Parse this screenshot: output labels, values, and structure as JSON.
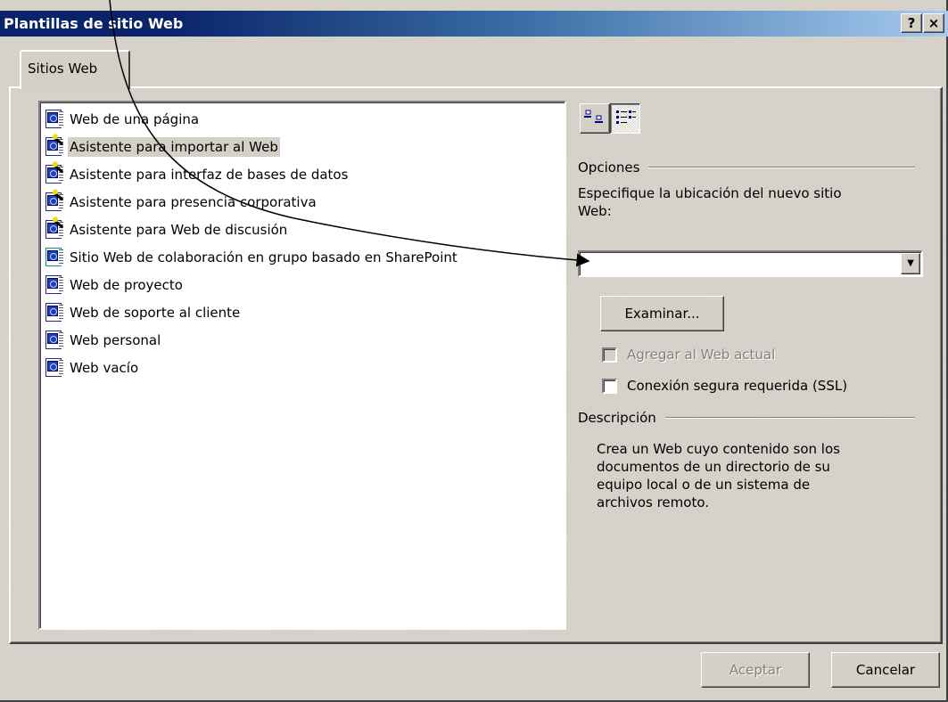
{
  "window": {
    "title": "Plantillas de sitio Web",
    "help_button": "?",
    "close_button": "×"
  },
  "tabs": [
    {
      "label": "Sitios Web"
    }
  ],
  "templates": [
    {
      "label": "Web de una página",
      "icon": "web-page-icon"
    },
    {
      "label": "Asistente para importar al Web",
      "icon": "wizard-icon",
      "selected": true
    },
    {
      "label": "Asistente para interfaz de bases de datos",
      "icon": "wizard-icon"
    },
    {
      "label": "Asistente para presencia corporativa",
      "icon": "wizard-icon"
    },
    {
      "label": "Asistente para Web de discusión",
      "icon": "wizard-icon"
    },
    {
      "label": "Sitio Web de colaboración en grupo basado en SharePoint",
      "icon": "sharepoint-icon"
    },
    {
      "label": "Web de proyecto",
      "icon": "web-page-icon"
    },
    {
      "label": "Web de soporte al cliente",
      "icon": "web-page-icon"
    },
    {
      "label": "Web personal",
      "icon": "web-page-icon"
    },
    {
      "label": "Web vacío",
      "icon": "web-page-icon"
    }
  ],
  "view_buttons": [
    {
      "icon": "large-icons-view-icon",
      "pressed": false
    },
    {
      "icon": "list-view-icon",
      "pressed": true
    }
  ],
  "options": {
    "group_label": "Opciones",
    "location_label_line1": "Especifique la ubicación del nuevo sitio",
    "location_label_line2": "Web:",
    "location_value": "",
    "browse_button": "Examinar...",
    "add_to_current_web": "Agregar al Web actual",
    "secure_connection": "Conexión segura requerida (SSL)"
  },
  "description": {
    "group_label": "Descripción",
    "lines": [
      "Crea un Web cuyo contenido son los",
      "documentos de un directorio de su",
      "equipo local o de un sistema de",
      "archivos remoto."
    ]
  },
  "footer": {
    "accept_button": "Aceptar",
    "cancel_button": "Cancelar"
  }
}
